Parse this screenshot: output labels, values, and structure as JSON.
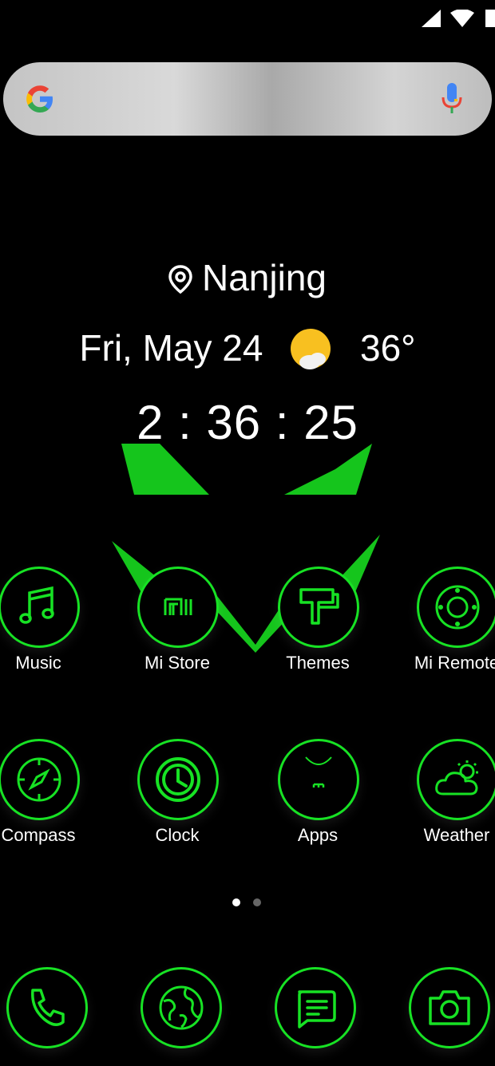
{
  "status_bar": {
    "icons": [
      "signal-icon",
      "wifi-icon",
      "battery-icon"
    ]
  },
  "search": {
    "logo": "google-g-logo",
    "mic": "mic-icon"
  },
  "widget": {
    "location": "Nanjing",
    "date": "Fri, May 24",
    "temperature": "36°",
    "weather_icon": "sunny-cloud-icon",
    "time": "2 : 36 : 25"
  },
  "apps_row1": [
    {
      "label": "Music",
      "icon": "music-icon"
    },
    {
      "label": "Mi Store",
      "icon": "mi-store-icon"
    },
    {
      "label": "Themes",
      "icon": "paint-roller-icon"
    },
    {
      "label": "Mi Remote",
      "icon": "remote-icon"
    }
  ],
  "apps_row2": [
    {
      "label": "Compass",
      "icon": "compass-icon"
    },
    {
      "label": "Clock",
      "icon": "clock-icon"
    },
    {
      "label": "Apps",
      "icon": "shopping-bag-icon"
    },
    {
      "label": "Weather",
      "icon": "weather-icon"
    }
  ],
  "dock": [
    {
      "icon": "phone-icon"
    },
    {
      "icon": "browser-globe-icon"
    },
    {
      "icon": "messages-icon"
    },
    {
      "icon": "camera-icon"
    }
  ],
  "page_indicator": {
    "pages": 2,
    "current": 1
  },
  "colors": {
    "accent": "#17e224",
    "background": "#000000",
    "text": "#ffffff"
  }
}
